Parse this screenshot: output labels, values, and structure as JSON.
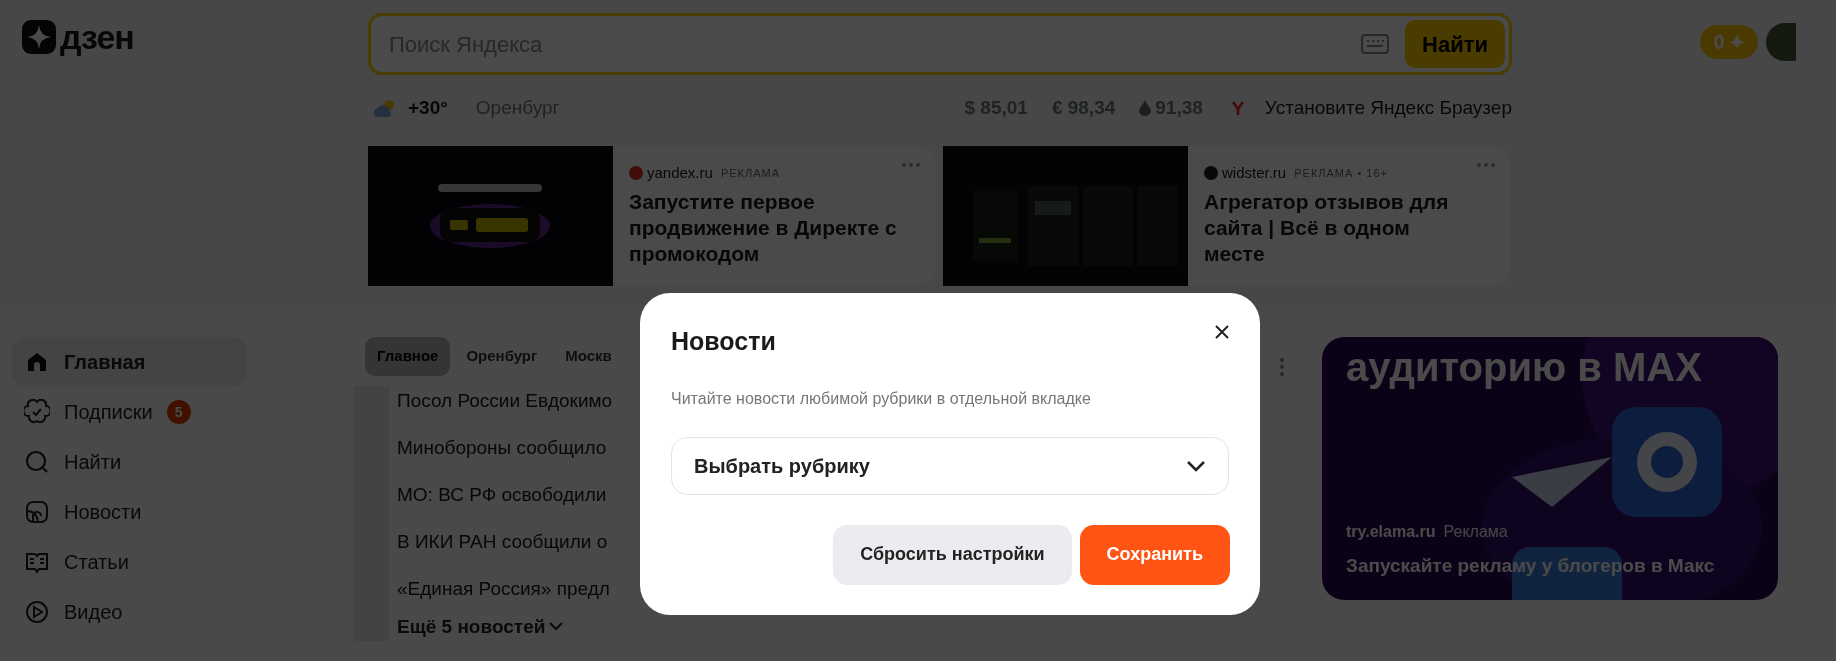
{
  "header": {
    "logo": "дзен",
    "search": {
      "placeholder": "Поиск Яндекса",
      "button": "Найти"
    },
    "points": "0"
  },
  "info_bar": {
    "temperature": "+30°",
    "city": "Оренбург",
    "rates": [
      {
        "kind": "currency",
        "text": "$ 85,01"
      },
      {
        "kind": "currency",
        "text": "€ 98,34"
      },
      {
        "kind": "oil",
        "text": "91,38"
      }
    ],
    "promo": "Установите Яндекс Браузер"
  },
  "ads": [
    {
      "source": "yandex.ru",
      "label": "РЕКЛАМА",
      "title": "Запустите первое продвижение в Директе с промокодом"
    },
    {
      "source": "widster.ru",
      "label": "РЕКЛАМА • 16+",
      "title": "Агрегатор отзывов для сайта | Всё в одном месте"
    }
  ],
  "sidebar": {
    "items": [
      {
        "kind": "home",
        "label": "Главная",
        "selected": true
      },
      {
        "kind": "subscriptions",
        "label": "Подписки",
        "selected": false,
        "badge": "5"
      },
      {
        "kind": "search",
        "label": "Найти",
        "selected": false
      },
      {
        "kind": "news",
        "label": "Новости",
        "selected": false
      },
      {
        "kind": "articles",
        "label": "Статьи",
        "selected": false
      },
      {
        "kind": "video",
        "label": "Видео",
        "selected": false
      }
    ]
  },
  "news": {
    "tabs": [
      {
        "label": "Главное",
        "selected": true
      },
      {
        "label": "Оренбург",
        "selected": false
      },
      {
        "label": "Москв",
        "selected": false
      }
    ],
    "headlines": [
      "Посол России Евдокимо",
      "Минобороны сообщило",
      "МО: ВС РФ освободили",
      "В ИКИ РАН сообщили о",
      "«Единая Россия» предл"
    ],
    "more": "Ещё 5 новостей"
  },
  "side_ad": {
    "headline": "аудиторию в MAX",
    "source": "try.elama.ru",
    "label": "Реклама",
    "text": "Запускайте рекламу у блогеров в Макс"
  },
  "modal": {
    "title": "Новости",
    "description": "Читайте новости любимой рубрики в отдельной вкладке",
    "select": {
      "placeholder": "Выбрать рубрику"
    },
    "buttons": [
      {
        "kind": "secondary",
        "label": "Сбросить настройки"
      },
      {
        "kind": "primary",
        "label": "Сохранить"
      }
    ]
  }
}
